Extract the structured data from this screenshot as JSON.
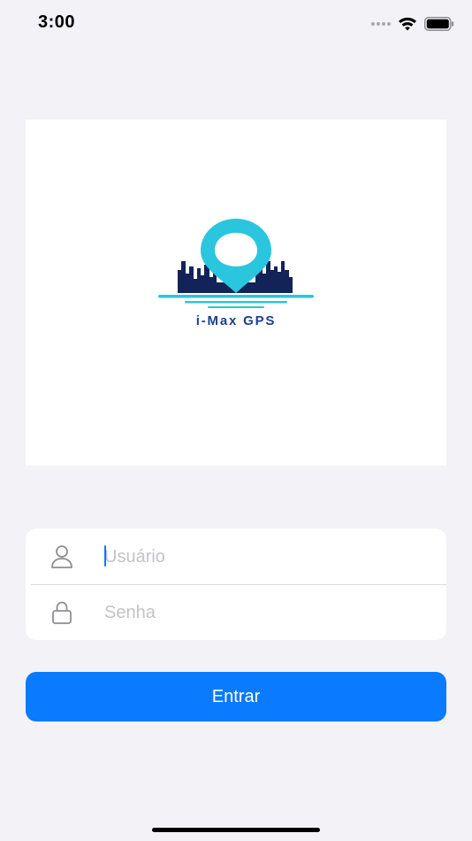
{
  "status_bar": {
    "time": "3:00",
    "icons": [
      "cellular-signal-icon",
      "wifi-icon",
      "battery-icon"
    ]
  },
  "logo": {
    "brand_name": "i-Max GPS",
    "icon": "map-pin-city-skyline-logo",
    "colors": {
      "pin": "#2ac6dd",
      "skyline": "#13235a",
      "water": "#2ac6dd",
      "brand_text": "#1d3f8e"
    }
  },
  "login_form": {
    "username": {
      "icon": "person-icon",
      "placeholder": "Usuário",
      "value": ""
    },
    "password": {
      "icon": "lock-icon",
      "placeholder": "Senha",
      "value": ""
    }
  },
  "login_button": {
    "label": "Entrar",
    "color": "#0a7aff"
  }
}
